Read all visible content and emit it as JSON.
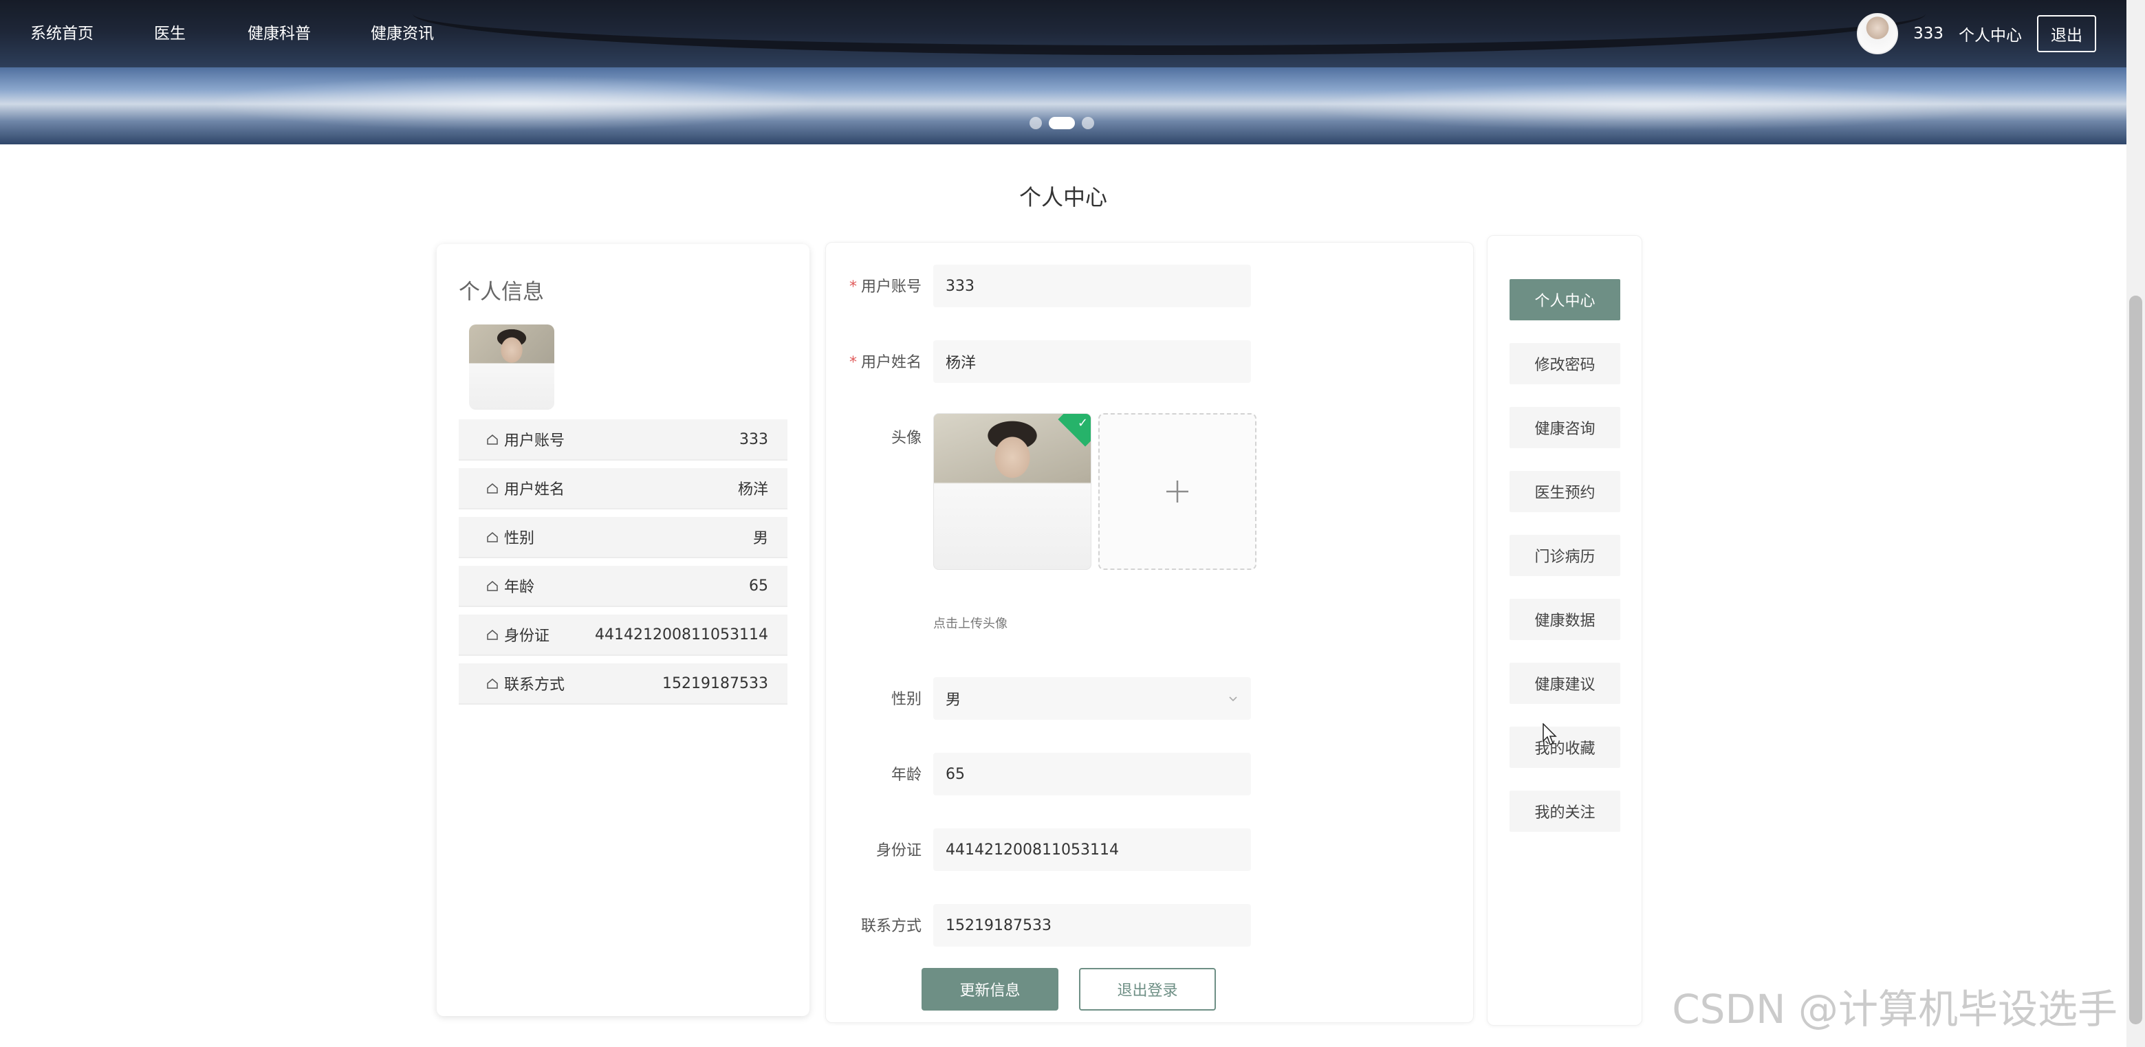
{
  "nav": {
    "items": [
      "系统首页",
      "医生",
      "健康科普",
      "健康资讯"
    ],
    "username": "333",
    "center_link": "个人中心",
    "logout": "退出"
  },
  "page_title": "个人中心",
  "info_card": {
    "title": "个人信息",
    "rows": [
      {
        "label": "用户账号",
        "value": "333"
      },
      {
        "label": "用户姓名",
        "value": "杨洋"
      },
      {
        "label": "性别",
        "value": "男"
      },
      {
        "label": "年龄",
        "value": "65"
      },
      {
        "label": "身份证",
        "value": "441421200811053114"
      },
      {
        "label": "联系方式",
        "value": "15219187533"
      }
    ]
  },
  "form": {
    "account": {
      "label": "用户账号",
      "value": "333"
    },
    "name": {
      "label": "用户姓名",
      "value": "杨洋"
    },
    "avatar": {
      "label": "头像",
      "hint": "点击上传头像"
    },
    "gender": {
      "label": "性别",
      "value": "男"
    },
    "age": {
      "label": "年龄",
      "value": "65"
    },
    "id_card": {
      "label": "身份证",
      "value": "441421200811053114"
    },
    "phone": {
      "label": "联系方式",
      "value": "15219187533"
    },
    "update_button": "更新信息",
    "logout_button": "退出登录"
  },
  "side_menu": {
    "items": [
      "个人中心",
      "修改密码",
      "健康咨询",
      "医生预约",
      "门诊病历",
      "健康数据",
      "健康建议",
      "我的收藏",
      "我的关注"
    ],
    "active_index": 0
  },
  "watermark": "CSDN @计算机毕设选手",
  "colors": {
    "accent": "#6e8f85",
    "required": "#e05a5a",
    "upload_success": "#26b36a"
  }
}
